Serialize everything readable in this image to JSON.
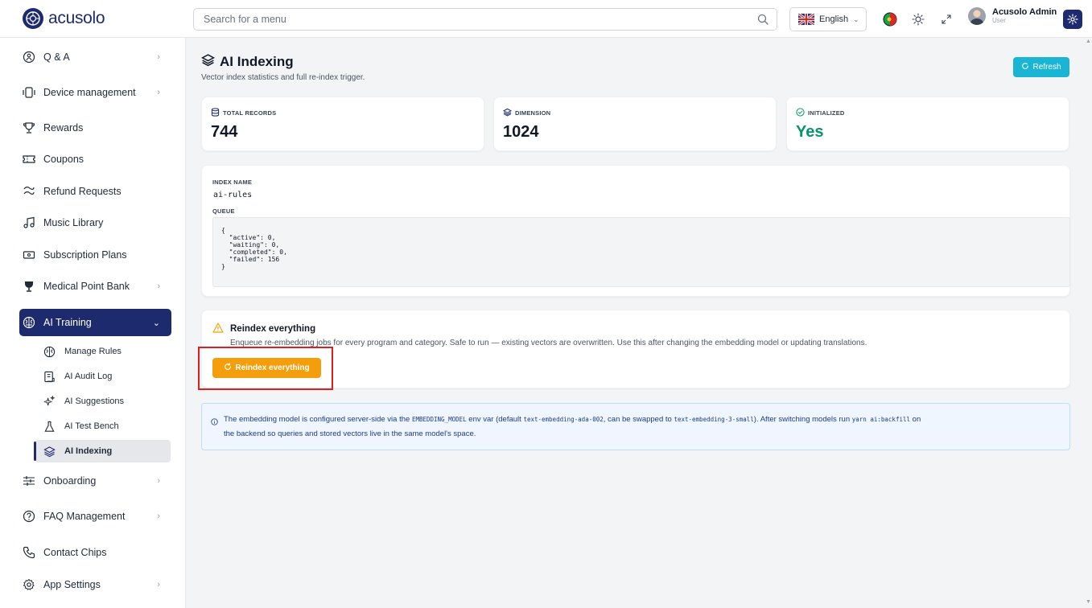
{
  "header": {
    "logo_text": "acusolo",
    "search_placeholder": "Search for a menu",
    "language": "English",
    "user_name": "Acusolo Admin",
    "user_role": "User"
  },
  "sidebar": {
    "items": [
      {
        "label": "Q & A",
        "icon": "qa-icon",
        "has_chevron": true
      },
      {
        "label": "Device management",
        "icon": "device-icon",
        "has_chevron": true
      },
      {
        "label": "Rewards",
        "icon": "trophy-icon",
        "has_chevron": false
      },
      {
        "label": "Coupons",
        "icon": "ticket-icon",
        "has_chevron": false
      },
      {
        "label": "Refund Requests",
        "icon": "refund-icon",
        "has_chevron": false
      },
      {
        "label": "Music Library",
        "icon": "music-icon",
        "has_chevron": false
      },
      {
        "label": "Subscription Plans",
        "icon": "plan-icon",
        "has_chevron": false
      },
      {
        "label": "Medical Point Bank",
        "icon": "medal-icon",
        "has_chevron": true
      },
      {
        "label": "AI Training",
        "icon": "brain-icon",
        "has_chevron": true,
        "expanded": true
      },
      {
        "label": "Onboarding",
        "icon": "sliders-icon",
        "has_chevron": true
      },
      {
        "label": "FAQ Management",
        "icon": "help-circle-icon",
        "has_chevron": true
      },
      {
        "label": "Contact Chips",
        "icon": "phone-icon",
        "has_chevron": false
      },
      {
        "label": "App Settings",
        "icon": "gear-icon",
        "has_chevron": true
      }
    ],
    "ai_training_children": [
      {
        "label": "Manage Rules",
        "icon": "brain-icon"
      },
      {
        "label": "AI Audit Log",
        "icon": "log-icon"
      },
      {
        "label": "AI Suggestions",
        "icon": "sparkles-icon"
      },
      {
        "label": "AI Test Bench",
        "icon": "flask-icon"
      },
      {
        "label": "AI Indexing",
        "icon": "layers-icon",
        "current": true
      }
    ]
  },
  "main": {
    "title": "AI Indexing",
    "subtitle": "Vector index statistics and full re-index trigger.",
    "refresh_label": "Refresh",
    "stats": [
      {
        "label": "TOTAL RECORDS",
        "value": "744",
        "icon": "database-icon"
      },
      {
        "label": "DIMENSION",
        "value": "1024",
        "icon": "layers-icon"
      },
      {
        "label": "INITIALIZED",
        "value": "Yes",
        "icon": "check-circle-icon"
      }
    ],
    "index_name_label": "INDEX NAME",
    "index_name": "ai-rules",
    "queue_label": "QUEUE",
    "queue_json": "{\n  \"active\": 0,\n  \"waiting\": 0,\n  \"completed\": 0,\n  \"failed\": 156\n}",
    "reindex": {
      "title": "Reindex everything",
      "description": "Enqueue re-embedding jobs for every program and category. Safe to run — existing vectors are overwritten. Use this after changing the embedding model or updating translations.",
      "button_label": "Reindex everything"
    },
    "info": {
      "l1_a": "The embedding model is configured server-side via the ",
      "l1_code1": "EMBEDDING_MODEL",
      "l1_b": " env var (default ",
      "l1_code2": "text-embedding-ada-002",
      "l1_c": ", can be swapped to ",
      "l1_code3": "text-embedding-3-small",
      "l1_d": "). After switching models run ",
      "l1_code4": "yarn ai:backfill",
      "l1_e": " on",
      "l2": "the backend so queries and stored vectors live in the same model's space."
    }
  },
  "colors": {
    "brand": "#1e2a6e",
    "refresh": "#1ab5d4",
    "reindex": "#f59e0b",
    "success": "#059669",
    "highlight": "#e11d1d"
  }
}
